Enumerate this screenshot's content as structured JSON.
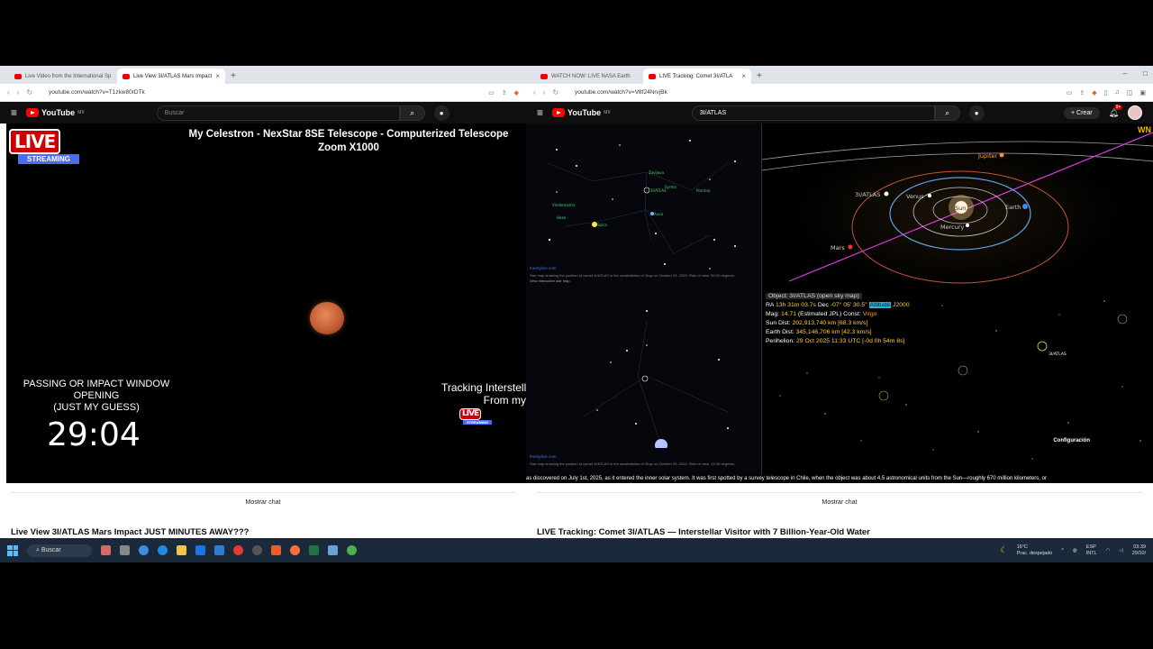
{
  "left_window": {
    "tabs": [
      {
        "label": "Live Video from the International Sp"
      },
      {
        "label": "Live View 3I/ATLAS Mars Impact"
      }
    ],
    "url": "youtube.com/watch?v=T1zkw80rDTk",
    "search_placeholder": "Buscar",
    "logo_text": "YouTube",
    "logo_region": "MX",
    "video": {
      "live_label": "LIVE",
      "streaming_label": "STREAMING",
      "title_line1": "My Celestron - NexStar 8SE Telescope - Computerized Telescope",
      "title_line2": "Zoom X1000",
      "passing_line1": "PASSING OR IMPACT WINDOW",
      "passing_line2": "OPENING",
      "passing_line3": "(JUST MY GUESS)",
      "countdown": "29:04",
      "tracking_line1": "Tracking Interstell",
      "tracking_line2": "From my",
      "small_live": "LIVE",
      "small_streaming": "STREAMING"
    },
    "show_chat": "Mostrar chat",
    "video_title": "Live View 3I/ATLAS Mars Impact JUST MINUTES AWAY???"
  },
  "right_window": {
    "tabs": [
      {
        "label": "WATCH NOW: LIVE NASA Earth"
      },
      {
        "label": "LIVE Tracking: Comet 3I/ATLA"
      }
    ],
    "url": "youtube.com/watch?v=V8f24NrvjBk",
    "search_value": "3I/ATLAS",
    "logo_text": "YouTube",
    "logo_region": "MX",
    "create_label": "Crear",
    "notification_count": "9+",
    "sky_site": "theskylive.com",
    "sky_caption_top": "Star map showing the position of comet 3I/ATLAS in the constellation of Virgo on October 29, 2025. Field of view: 50.00 degrees.",
    "sky_caption_top2": "View interactive star map",
    "sky_caption_bottom": "Star map showing the position of comet 3I/ATLAS in the constellation of Virgo on October 29, 2025. Field of view: 15.00 degrees.",
    "sky_stars_top": [
      "Spica",
      "3I/ATLAS",
      "Porrima",
      "Vindemiatrix",
      "Zavijava",
      "Heze",
      "Syrma",
      "Auva"
    ],
    "solar_labels": {
      "jupiter": "Jupiter",
      "atlas": "3I/ATLAS",
      "venus": "Venus",
      "sun": "Sun",
      "earth": "Earth",
      "mercury": "Mercury",
      "mars": "Mars",
      "logo": "WN"
    },
    "info": {
      "object": "Object: 3I/ATLAS   (open sky map)",
      "ra_label": "RA",
      "ra": "13h 31m 03.7s",
      "dec_label": "Dec",
      "dec": "-07° 05' 30.5\"",
      "epoch_tag": "Altitude",
      "epoch": "J2000",
      "mag_label": "Mag:",
      "mag": "14.71",
      "mag_note": "(Estimated JPL)",
      "const_label": "Const:",
      "const": "Virgo",
      "sun_dist_label": "Sun Dist:",
      "sun_dist": "202,913,740 km [68.3 km/s]",
      "earth_dist_label": "Earth Dist:",
      "earth_dist": "345,146,706 km [42.3 km/s]",
      "perihelion_label": "Perihelion:",
      "perihelion": "29 Oct 2025 11:33 UTC [-0d 0h 54m 8s]"
    },
    "star_field_labels": [
      "3I/ATLAS",
      "Configuración"
    ],
    "ticker": "as discovered on July 1st, 2025, as it entered the inner solar system. It was first spotted by a survey telescope in Chile, when the object was about 4.5 astronomical units from the Sun—roughly 670 million kilometers, or",
    "show_chat": "Mostrar chat",
    "video_title": "LIVE Tracking: Comet 3I/ATLAS — Interstellar Visitor with 7 Billion-Year-Old Water"
  },
  "taskbar": {
    "search_label": "Buscar",
    "weather_temp": "16°C",
    "weather_desc": "Prac. despejado",
    "lang1": "ESP",
    "lang2": "INTL",
    "time": "03:39",
    "date": "29/10/"
  }
}
